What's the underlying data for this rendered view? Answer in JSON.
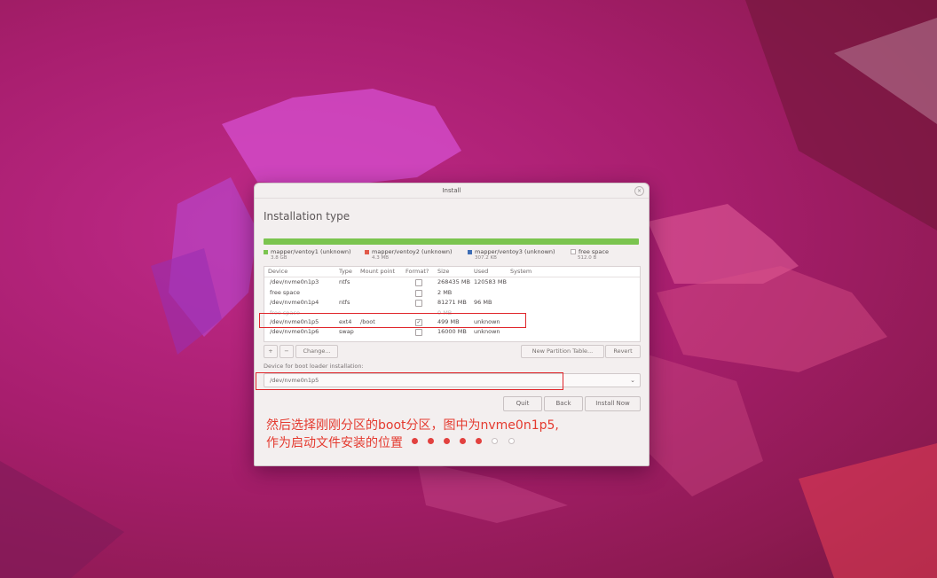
{
  "window": {
    "title": "Install",
    "close_icon": "close-icon"
  },
  "page": {
    "title": "Installation type"
  },
  "legend": [
    {
      "label": "mapper/ventoy1 (unknown)",
      "size": "3.8 GB",
      "color": "#7bc44f"
    },
    {
      "label": "mapper/ventoy2 (unknown)",
      "size": "4.3 MB",
      "color": "#e15a4a"
    },
    {
      "label": "mapper/ventoy3 (unknown)",
      "size": "307.2 KB",
      "color": "#3e6db5"
    },
    {
      "label": "free space",
      "size": "512.0 B",
      "color": "#ffffff"
    }
  ],
  "table": {
    "headers": {
      "device": "Device",
      "type": "Type",
      "mount": "Mount point",
      "format": "Format?",
      "size": "Size",
      "used": "Used",
      "system": "System"
    },
    "rows": [
      {
        "device": "/dev/nvme0n1p3",
        "type": "ntfs",
        "mount": "",
        "format": false,
        "size": "268435 MB",
        "used": "120583 MB",
        "system": ""
      },
      {
        "device": "free space",
        "type": "",
        "mount": "",
        "format": false,
        "size": "2 MB",
        "used": "",
        "system": ""
      },
      {
        "device": "/dev/nvme0n1p4",
        "type": "ntfs",
        "mount": "",
        "format": false,
        "size": "81271 MB",
        "used": "96 MB",
        "system": ""
      },
      {
        "device": "free space",
        "type": "",
        "mount": "",
        "format": false,
        "size": "0 MB",
        "used": "",
        "system": ""
      },
      {
        "device": "/dev/nvme0n1p5",
        "type": "ext4",
        "mount": "/boot",
        "format": true,
        "size": "499 MB",
        "used": "unknown",
        "system": ""
      },
      {
        "device": "/dev/nvme0n1p6",
        "type": "swap",
        "mount": "",
        "format": false,
        "size": "16000 MB",
        "used": "unknown",
        "system": ""
      }
    ]
  },
  "table_buttons": {
    "add": "+",
    "remove": "−",
    "change": "Change...",
    "new_table": "New Partition Table...",
    "revert": "Revert"
  },
  "boot_loader": {
    "label": "Device for boot loader installation:",
    "value": "/dev/nvme0n1p5"
  },
  "footer": {
    "quit": "Quit",
    "back": "Back",
    "install": "Install Now"
  },
  "annotation": {
    "line1": "然后选择刚刚分区的boot分区，图中为nvme0n1p5,",
    "line2": "作为启动文件安装的位置"
  },
  "progress": {
    "total": 7,
    "completed": 5
  },
  "colors": {
    "highlight_box": "#e0262b",
    "annotation_text": "#e43a2f",
    "accent_dot": "#e2413f"
  }
}
